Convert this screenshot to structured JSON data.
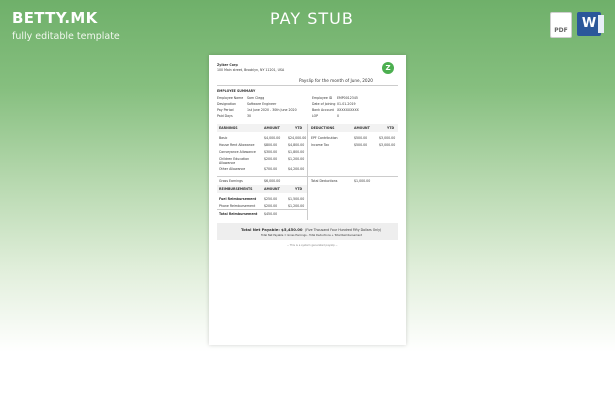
{
  "brand": "BETTY.MK",
  "tagline": "fully editable template",
  "page_title": "PAY STUB",
  "icons": {
    "pdf_label": "PDF",
    "word_label": "W"
  },
  "doc": {
    "company": "Zylker Corp",
    "address": "100 Main street, Brooklyn, NY 11201, USA",
    "logo_letter": "Z",
    "payslip_title": "Payslip for the month of June, 2020",
    "emp_summary": "EMPLOYEE SUMMARY",
    "left_fields": [
      {
        "label": "Employee Name",
        "value": "Sam Clegg"
      },
      {
        "label": "Designation",
        "value": "Software Engineer"
      },
      {
        "label": "Pay Period",
        "value": "1st June 2020 - 30th June 2020"
      },
      {
        "label": "Paid Days",
        "value": "30"
      }
    ],
    "right_fields": [
      {
        "label": "Employee ID",
        "value": "EMP0012345"
      },
      {
        "label": "Date of Joining",
        "value": "01-01-2019"
      },
      {
        "label": "Bank Account",
        "value": "XXXXXXXXXX"
      },
      {
        "label": "LOP",
        "value": "0"
      }
    ],
    "earnings": {
      "head": [
        "EARNINGS",
        "AMOUNT",
        "YTD"
      ],
      "rows": [
        [
          "Basic",
          "$4,000.00",
          "$24,000.00"
        ],
        [
          "House Rent Allowance",
          "$800.00",
          "$4,800.00"
        ],
        [
          "Conveyance Allowance",
          "$300.00",
          "$1,800.00"
        ],
        [
          "Children Education Allowance",
          "$200.00",
          "$1,200.00"
        ],
        [
          "Other Allowance",
          "$700.00",
          "$4,200.00"
        ]
      ],
      "total_label": "Gross Earnings",
      "total": "$6,000.00"
    },
    "deductions": {
      "head": [
        "DEDUCTIONS",
        "AMOUNT",
        "YTD"
      ],
      "rows": [
        [
          "EPF Contribution",
          "$500.00",
          "$3,000.00"
        ],
        [
          "Income Tax",
          "$500.00",
          "$3,000.00"
        ]
      ],
      "total_label": "Total Deductions",
      "total": "$1,000.00"
    },
    "reimb": {
      "head": [
        "REIMBURSEMENTS",
        "AMOUNT",
        "YTD"
      ],
      "rows": [
        [
          "Fuel Reimbursement",
          "$250.00",
          "$1,500.00"
        ],
        [
          "Phone Reimbursement",
          "$200.00",
          "$1,200.00"
        ]
      ],
      "total_label": "Total Reimbursement",
      "total": "$450.00"
    },
    "net_pay": "Total Net Payable: $5,450.00",
    "net_words": "(Five Thousand Four Hundred Fifty Dollars Only)",
    "net_note": "Total Net Payable = Gross Earnings - Total Deductions + Total Reimbursement",
    "footer": "-- This is a system generated payslip --"
  }
}
